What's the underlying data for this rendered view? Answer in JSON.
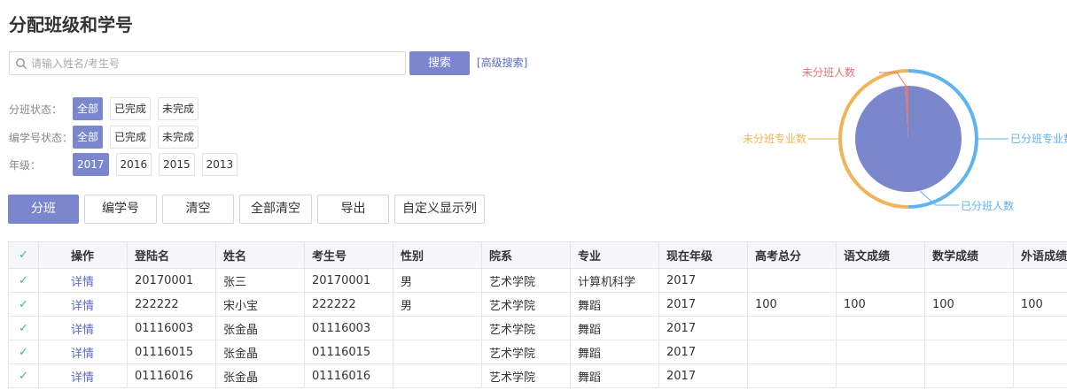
{
  "page": {
    "title": "分配班级和学号"
  },
  "search": {
    "placeholder": "请输入姓名/考生号",
    "value": "",
    "button": "搜索",
    "advanced": "[高级搜索]"
  },
  "filters": {
    "class_status": {
      "label": "分班状态：",
      "options": [
        "全部",
        "已完成",
        "未完成"
      ],
      "active": 0
    },
    "number_status": {
      "label": "编学号状态：",
      "options": [
        "全部",
        "已完成",
        "未完成"
      ],
      "active": 0
    },
    "grade": {
      "label": "年级：",
      "options": [
        "2017",
        "2016",
        "2015",
        "2013"
      ],
      "active": 0
    }
  },
  "actions": [
    "分班",
    "编学号",
    "清空",
    "全部清空",
    "导出",
    "自定义显示列"
  ],
  "table": {
    "headers": [
      "操作",
      "登陆名",
      "姓名",
      "考生号",
      "性别",
      "院系",
      "专业",
      "现在年级",
      "高考总分",
      "语文成绩",
      "数学成绩",
      "外语成绩"
    ],
    "rows": [
      [
        "详情",
        "20170001",
        "张三",
        "20170001",
        "男",
        "艺术学院",
        "计算机科学",
        "2017",
        "",
        "",
        "",
        ""
      ],
      [
        "详情",
        "222222",
        "宋小宝",
        "222222",
        "男",
        "艺术学院",
        "舞蹈",
        "2017",
        "100",
        "100",
        "100",
        "100"
      ],
      [
        "详情",
        "01116003",
        "张金晶",
        "01116003",
        "",
        "艺术学院",
        "舞蹈",
        "2017",
        "",
        "",
        "",
        ""
      ],
      [
        "详情",
        "01116015",
        "张金晶",
        "01116015",
        "",
        "艺术学院",
        "舞蹈",
        "2017",
        "",
        "",
        "",
        ""
      ],
      [
        "详情",
        "01116016",
        "张金晶",
        "01116016",
        "",
        "艺术学院",
        "舞蹈",
        "2017",
        "",
        "",
        "",
        ""
      ]
    ]
  },
  "chart_data": {
    "type": "pie",
    "inner": {
      "labels": [
        "已分班人数",
        "未分班人数"
      ],
      "values": [
        99,
        1
      ],
      "colors": [
        "#7b87cc",
        "#e8736f"
      ]
    },
    "outer": {
      "labels": [
        "已分班专业数",
        "未分班专业数"
      ],
      "values": [
        50,
        50
      ],
      "colors": [
        "#5fb3ef",
        "#f0b45a"
      ]
    }
  },
  "colors": {
    "accent": "#7b87cc",
    "check": "#3bb89b",
    "link": "#5b6bbf"
  }
}
